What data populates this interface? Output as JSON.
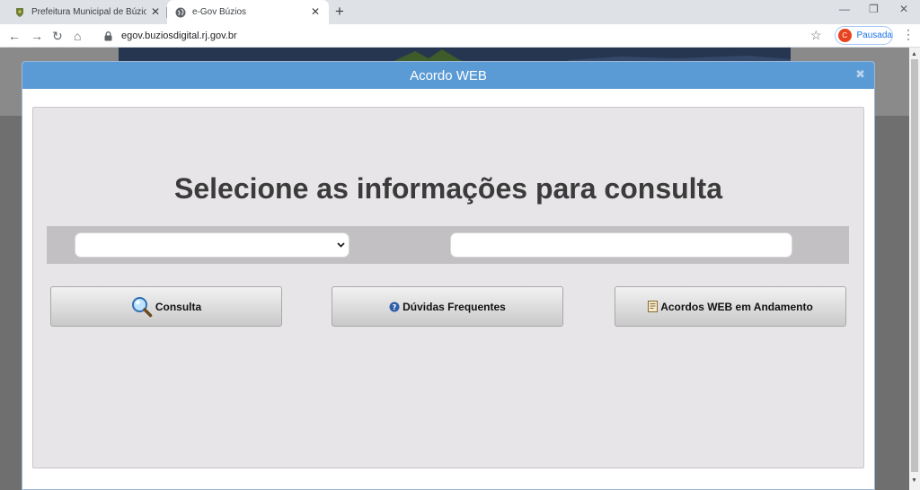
{
  "browser": {
    "tabs": [
      {
        "title": "Prefeitura Municipal de Búzios - P",
        "active": false,
        "favicon": "crest-favicon-icon"
      },
      {
        "title": "e-Gov Búzios",
        "active": true,
        "favicon": "globe-icon"
      }
    ],
    "address": "egov.buziosdigital.rj.gov.br",
    "profile": {
      "initial": "C",
      "status": "Pausada",
      "color": "#e8431f"
    }
  },
  "modal": {
    "title": "Acordo WEB",
    "header_color": "#5b9bd5",
    "heading": "Selecione as informações para consulta",
    "select": {
      "value": ""
    },
    "text_input": {
      "value": ""
    },
    "buttons": [
      {
        "label": "Consulta",
        "icon": "magnifier-icon"
      },
      {
        "label": "Dúvidas Frequentes",
        "icon": "help-icon"
      },
      {
        "label": "Acordos WEB em Andamento",
        "icon": "document-icon"
      }
    ]
  }
}
